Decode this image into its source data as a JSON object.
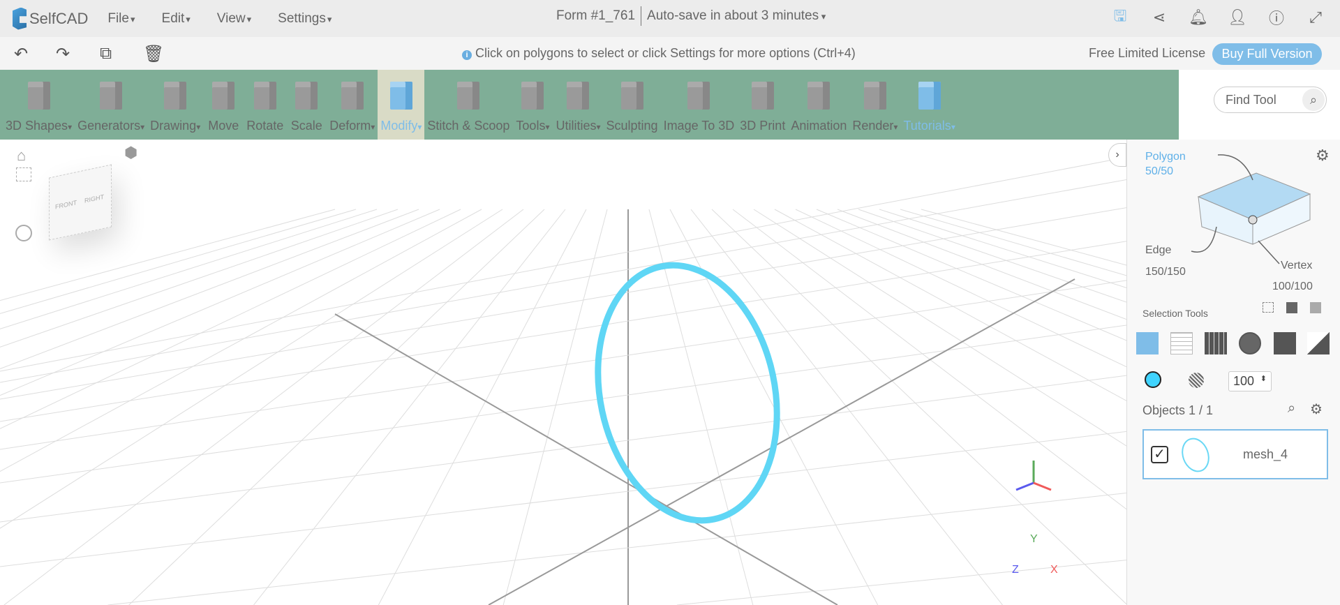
{
  "app": {
    "name": "SelfCAD"
  },
  "menu": [
    "File",
    "Edit",
    "View",
    "Settings"
  ],
  "document": {
    "title": "Form #1_761",
    "autosave": "Auto-save in about 3 minutes"
  },
  "hint": "Click on polygons to select or click Settings for more options (Ctrl+4)",
  "license": {
    "label": "Free Limited License",
    "buy": "Buy Full Version"
  },
  "tools": [
    {
      "label": "3D Shapes",
      "dropdown": true
    },
    {
      "label": "Generators",
      "dropdown": true
    },
    {
      "label": "Drawing",
      "dropdown": true
    },
    {
      "label": "Move"
    },
    {
      "label": "Rotate"
    },
    {
      "label": "Scale"
    },
    {
      "label": "Deform",
      "dropdown": true
    },
    {
      "label": "Modify",
      "dropdown": true,
      "active": true
    },
    {
      "label": "Stitch & Scoop"
    },
    {
      "label": "Tools",
      "dropdown": true
    },
    {
      "label": "Utilities",
      "dropdown": true
    },
    {
      "label": "Sculpting"
    },
    {
      "label": "Image To 3D"
    },
    {
      "label": "3D Print"
    },
    {
      "label": "Animation"
    },
    {
      "label": "Render",
      "dropdown": true
    },
    {
      "label": "Tutorials",
      "dropdown": true
    }
  ],
  "find_tool": {
    "placeholder": "Find Tool"
  },
  "viewcube": {
    "front": "FRONT",
    "right": "RIGHT"
  },
  "axes": {
    "x": "X",
    "y": "Y",
    "z": "Z"
  },
  "panel": {
    "polygon": {
      "label": "Polygon",
      "count": "50/50"
    },
    "edge": {
      "label": "Edge",
      "count": "150/150"
    },
    "vertex": {
      "label": "Vertex",
      "count": "100/100"
    },
    "selection_tools": "Selection Tools",
    "opacity": "100",
    "color": "#40d4ff",
    "objects": {
      "label": "Objects 1 / 1",
      "items": [
        {
          "name": "mesh_4",
          "checked": true
        }
      ]
    }
  },
  "colors": {
    "toolbar": "#7fae97",
    "accent": "#7fbde8",
    "ring": "#5fd6f5"
  }
}
